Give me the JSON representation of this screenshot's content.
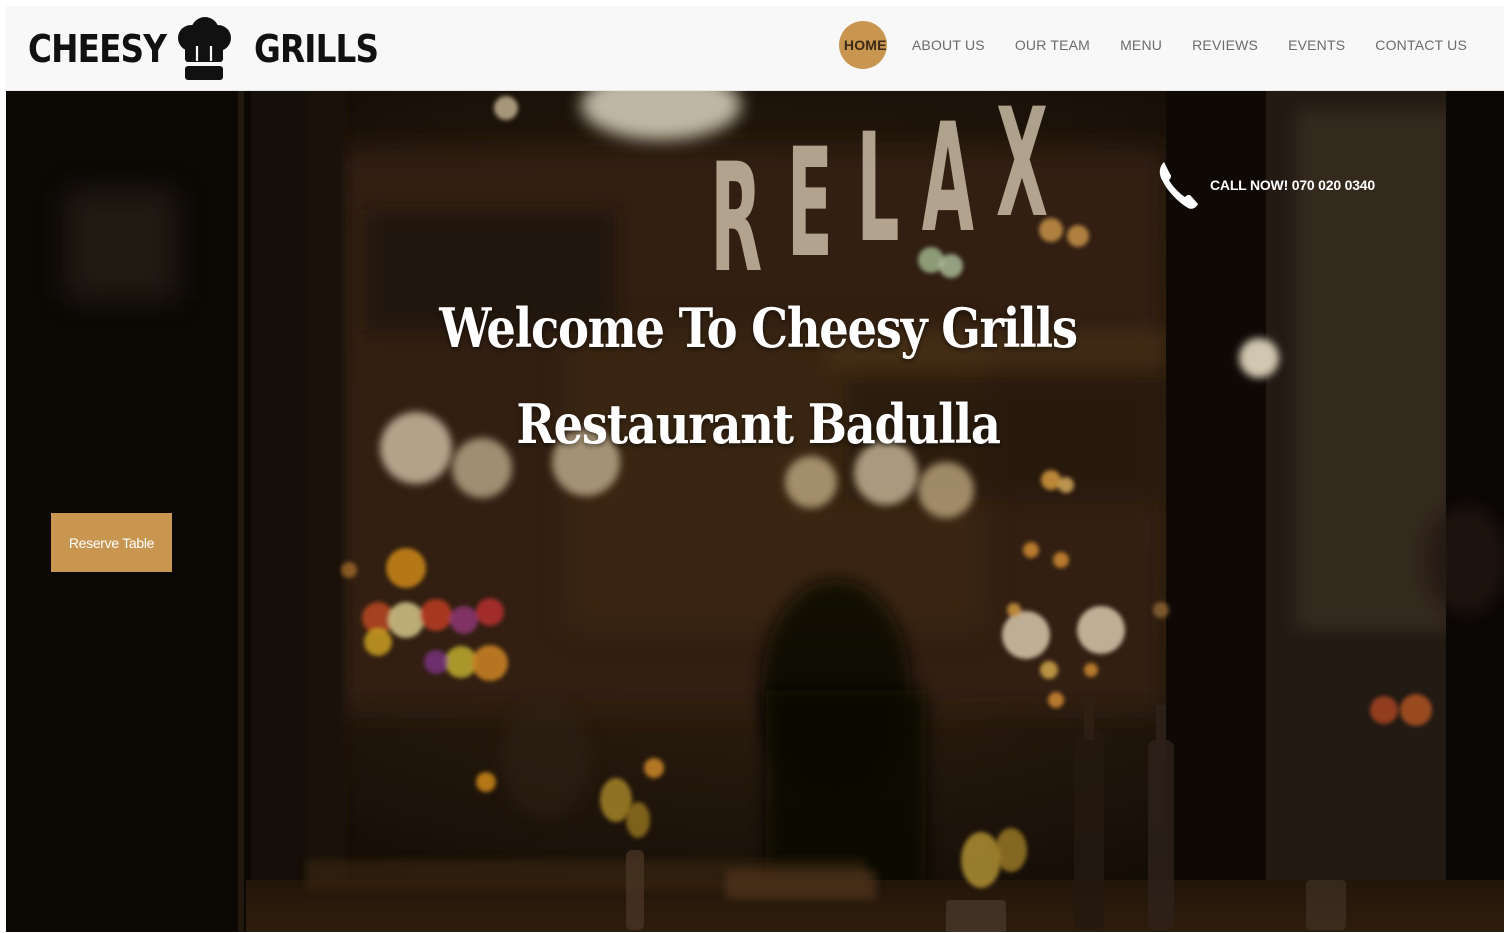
{
  "brand": {
    "word_left": "CHEESY",
    "word_right": "GRILLS",
    "logo_icon": "chef-hat-icon"
  },
  "nav": {
    "items": [
      {
        "label": "HOME",
        "active": true
      },
      {
        "label": "ABOUT US",
        "active": false
      },
      {
        "label": "OUR TEAM",
        "active": false
      },
      {
        "label": "MENU",
        "active": false
      },
      {
        "label": "REVIEWS",
        "active": false
      },
      {
        "label": "EVENTS",
        "active": false
      },
      {
        "label": "CONTACT US",
        "active": false
      }
    ],
    "active_color": "#c89650"
  },
  "hero": {
    "background": "blurred-restaurant-interior-with-relax-sign",
    "sign_text": "RELAX",
    "call_icon": "phone-icon",
    "call_text": "CALL NOW! 070 020 0340",
    "title_line1": "Welcome To Cheesy Grills",
    "title_line2": "Restaurant Badulla",
    "reserve_label": "Reserve Table",
    "accent_color": "#c89650"
  }
}
